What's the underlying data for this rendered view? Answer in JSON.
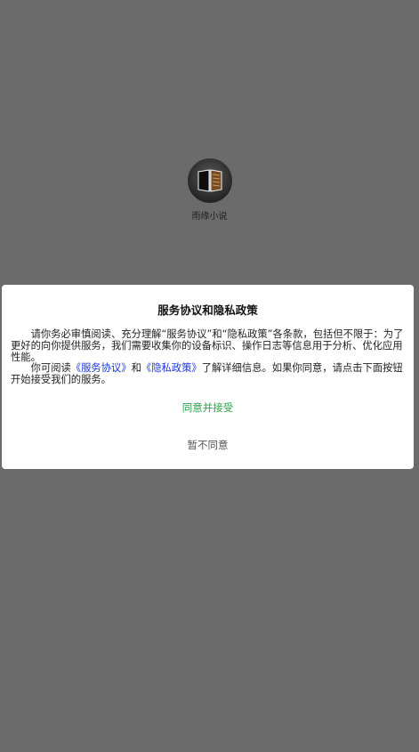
{
  "app": {
    "name": "雨缘小说",
    "icon": "book-icon"
  },
  "dialog": {
    "title": "服务协议和隐私政策",
    "paragraph1": "请你务必审慎阅读、充分理解“服务协议”和“隐私政策”各条款，包括但不限于：为了更好的向你提供服务，我们需要收集你的设备标识、操作日志等信息用于分析、优化应用性能。",
    "paragraph2_prefix": "你可阅读",
    "service_link": "《服务协议》",
    "and_text": "和",
    "privacy_link": "《隐私政策》",
    "paragraph2_suffix": "了解详细信息。如果你同意，请点击下面按钮开始接受我们的服务。",
    "agree_label": "同意并接受",
    "decline_label": "暂不同意"
  },
  "colors": {
    "overlay": "#6b6b6b",
    "link": "#1a36d6",
    "agree": "#2aa14a",
    "decline": "#555555"
  }
}
